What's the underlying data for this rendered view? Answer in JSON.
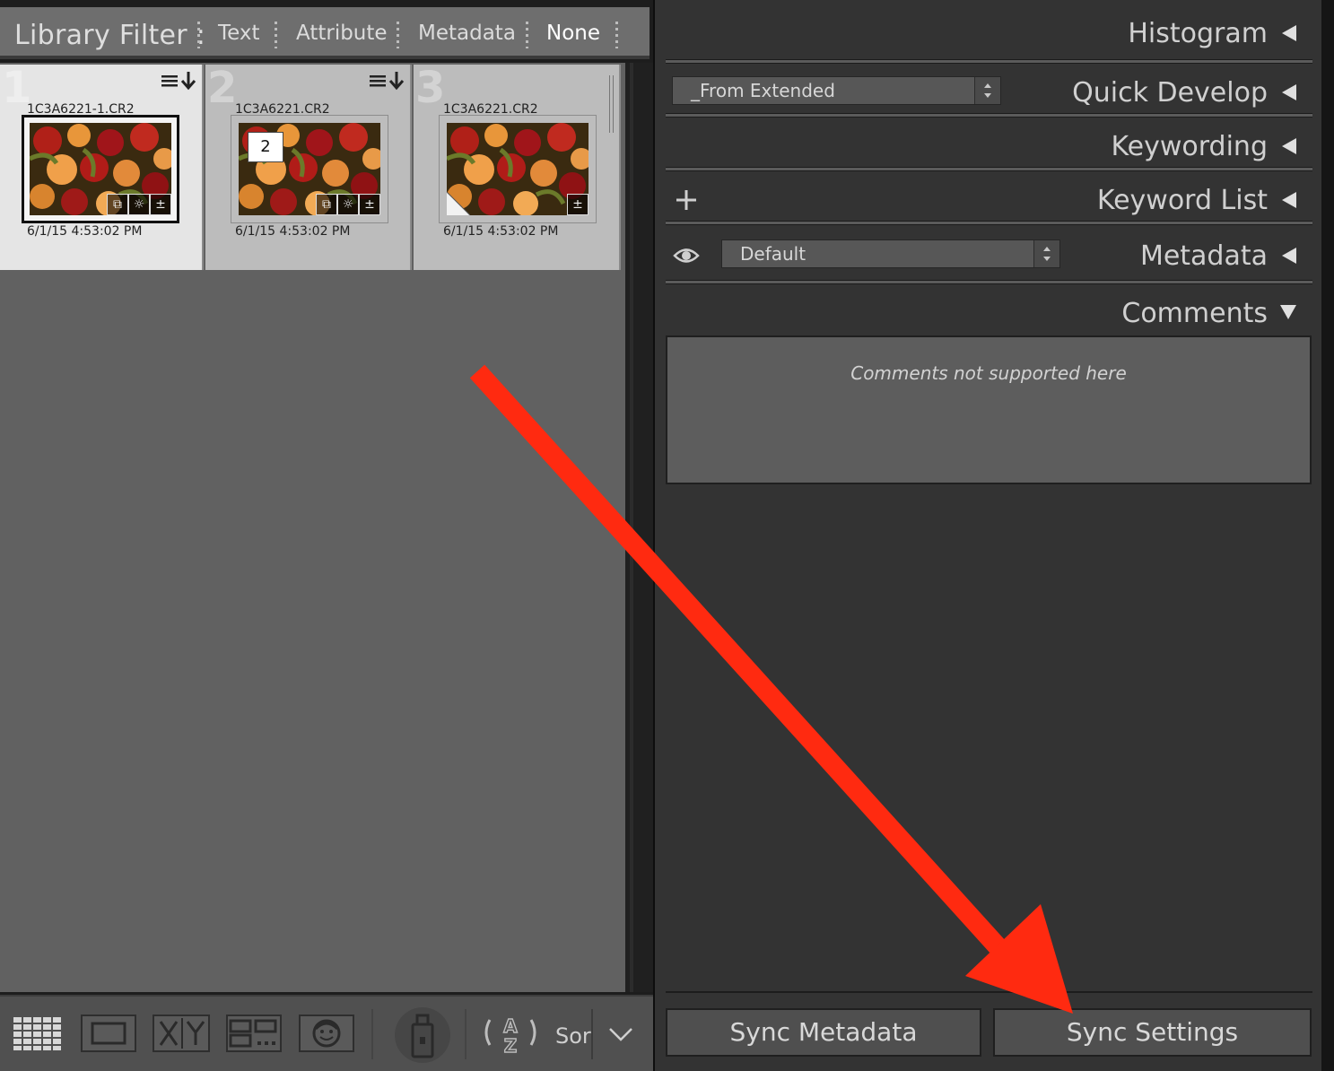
{
  "filter_bar": {
    "title": "Library Filter :",
    "tabs": [
      "Text",
      "Attribute",
      "Metadata",
      "None"
    ],
    "active_tab": "None"
  },
  "grid": {
    "cells": [
      {
        "index": "1",
        "filename": "1C3A6221-1.CR2",
        "date": "6/1/15 4:53:02 PM",
        "selected": true
      },
      {
        "index": "2",
        "filename": "1C3A6221.CR2",
        "date": "6/1/15 4:53:02 PM",
        "selected": false,
        "stack_count": "2"
      },
      {
        "index": "3",
        "filename": "1C3A6221.CR2",
        "date": "6/1/15 4:53:02 PM",
        "selected": false
      }
    ]
  },
  "toolbar": {
    "sort_label": "Sor",
    "buttons": [
      "grid-view-icon",
      "loupe-view-icon",
      "compare-view-icon",
      "survey-view-icon",
      "people-view-icon",
      "spray-can-icon",
      "sort-az-icon"
    ]
  },
  "right_panel": {
    "histogram": "Histogram",
    "quick_develop": "Quick Develop",
    "quick_develop_preset": "_From Extended",
    "keywording": "Keywording",
    "keyword_list": "Keyword List",
    "metadata": "Metadata",
    "metadata_preset": "Default",
    "comments": "Comments",
    "comments_message": "Comments not supported here",
    "sync_metadata": "Sync Metadata",
    "sync_settings": "Sync Settings"
  },
  "annotation": {
    "arrow_color": "#ff2a10",
    "arrow_target": "Sync Settings"
  }
}
